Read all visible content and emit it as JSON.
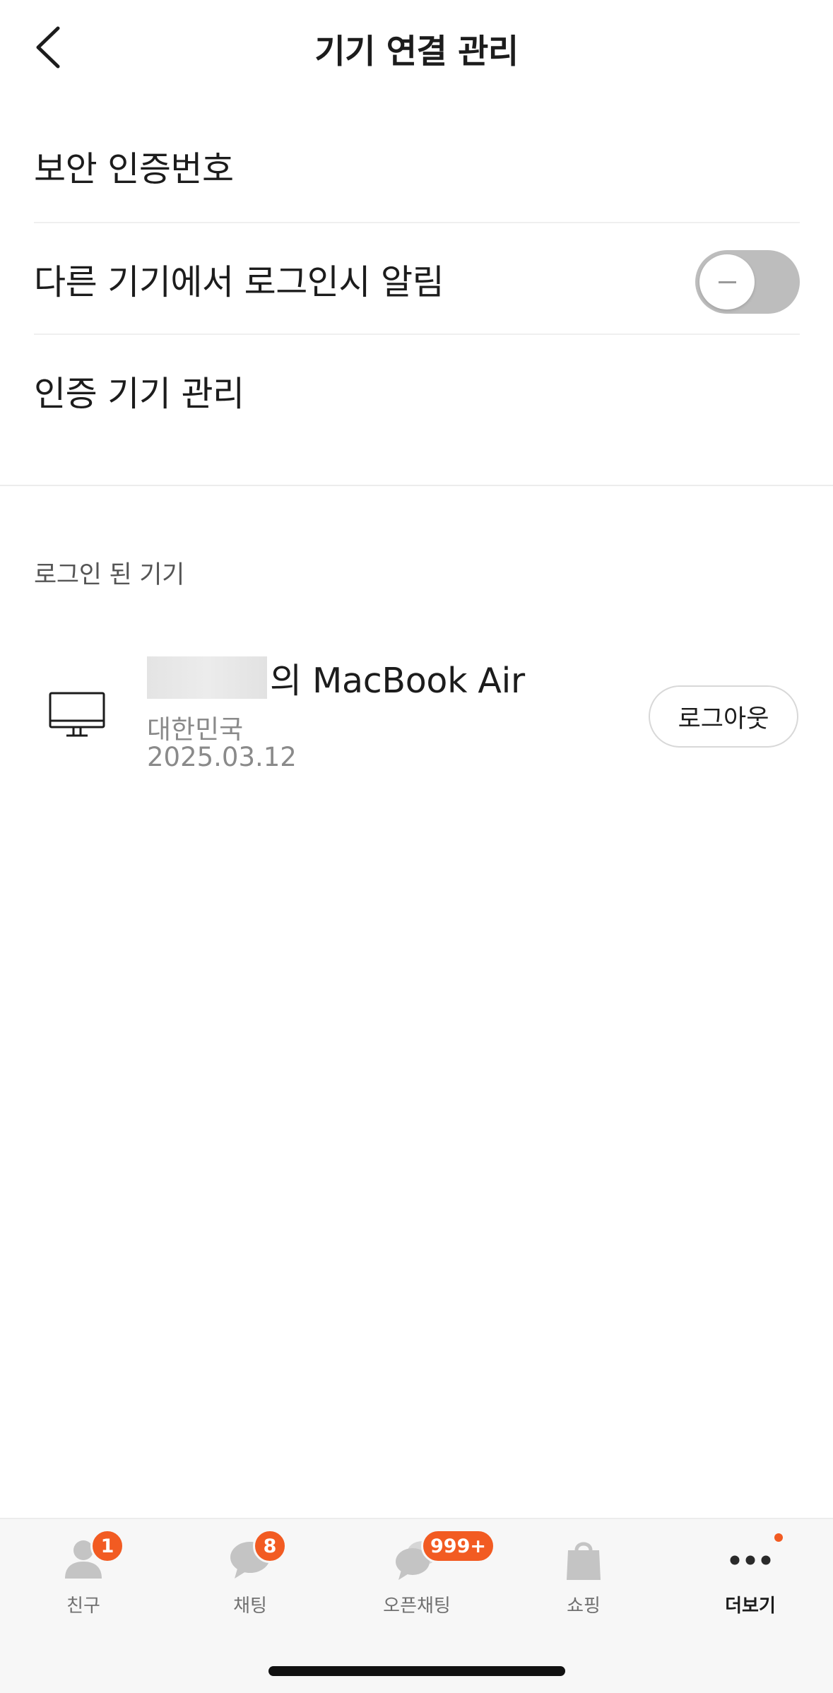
{
  "header": {
    "title": "기기 연결 관리"
  },
  "settings": {
    "security_code": "보안 인증번호",
    "login_alert": "다른 기기에서 로그인시 알림",
    "login_alert_enabled": false,
    "manage_devices": "인증 기기 관리"
  },
  "devices_section": {
    "label": "로그인 된 기기",
    "items": [
      {
        "name": "의 MacBook Air",
        "country": "대한민국",
        "date": "2025.03.12",
        "logout_label": "로그아웃"
      }
    ]
  },
  "tabbar": {
    "tabs": [
      {
        "label": "친구",
        "icon": "person-icon",
        "badge": "1"
      },
      {
        "label": "채팅",
        "icon": "chat-bubble-icon",
        "badge": "8"
      },
      {
        "label": "오픈채팅",
        "icon": "open-chat-icon",
        "badge": "999+"
      },
      {
        "label": "쇼핑",
        "icon": "shopping-bag-icon",
        "badge": ""
      },
      {
        "label": "더보기",
        "icon": "more-dots-icon",
        "badge": "",
        "active": true,
        "has_dot": true
      }
    ]
  },
  "colors": {
    "accent": "#f25b22",
    "toggle_off": "#bdbdbd",
    "tabbar_bg": "#f7f7f7"
  }
}
